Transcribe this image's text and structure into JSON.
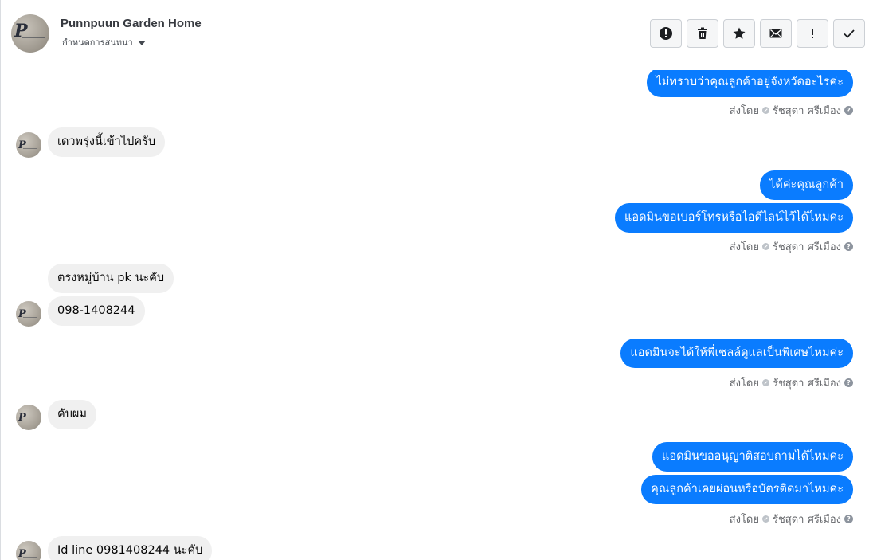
{
  "header": {
    "page_name": "Punnpuun Garden Home",
    "assign_label": "กำหนดการสนทนา",
    "toolbar": [
      {
        "name": "spam-button",
        "icon": "alert-circle-icon"
      },
      {
        "name": "delete-button",
        "icon": "trash-icon"
      },
      {
        "name": "star-button",
        "icon": "star-icon"
      },
      {
        "name": "mark-unread-button",
        "icon": "envelope-icon"
      },
      {
        "name": "follow-up-button",
        "icon": "exclamation-icon"
      },
      {
        "name": "mark-done-button",
        "icon": "check-icon"
      }
    ]
  },
  "messages": {
    "m1": "ไม่ทราบว่าคุณลูกค้าอยู่จังหวัดอะไรค่ะ",
    "m2": "เดวพรุ่งนี้เข้าไปครับ",
    "m3": "ได้ค่ะคุณลูกค้า",
    "m4": "แอดมินขอเบอร์โทรหรือไอดีไลน์ไว้ได้ไหมค่ะ",
    "m5": "ตรงหมู่บ้าน pk นะคับ",
    "m6": "098-1408244",
    "m7": "แอดมินจะได้ให้พี่เซลล์ดูแลเป็นพิเศษไหมค่ะ",
    "m8": "คับผม",
    "m9": "แอดมินขออนุญาติสอบถามได้ไหมค่ะ",
    "m10": "คุณลูกค้าเคยผ่อนหรือบัตรติดมาไหมค่ะ",
    "m11": "Id line 0981408244 นะคับ"
  },
  "sent_by": {
    "prefix": "ส่งโดย",
    "agent": "รัชสุดา ศรีเมือง"
  },
  "colors": {
    "outgoing": "#0a7cff",
    "incoming": "#f0f0f0"
  }
}
